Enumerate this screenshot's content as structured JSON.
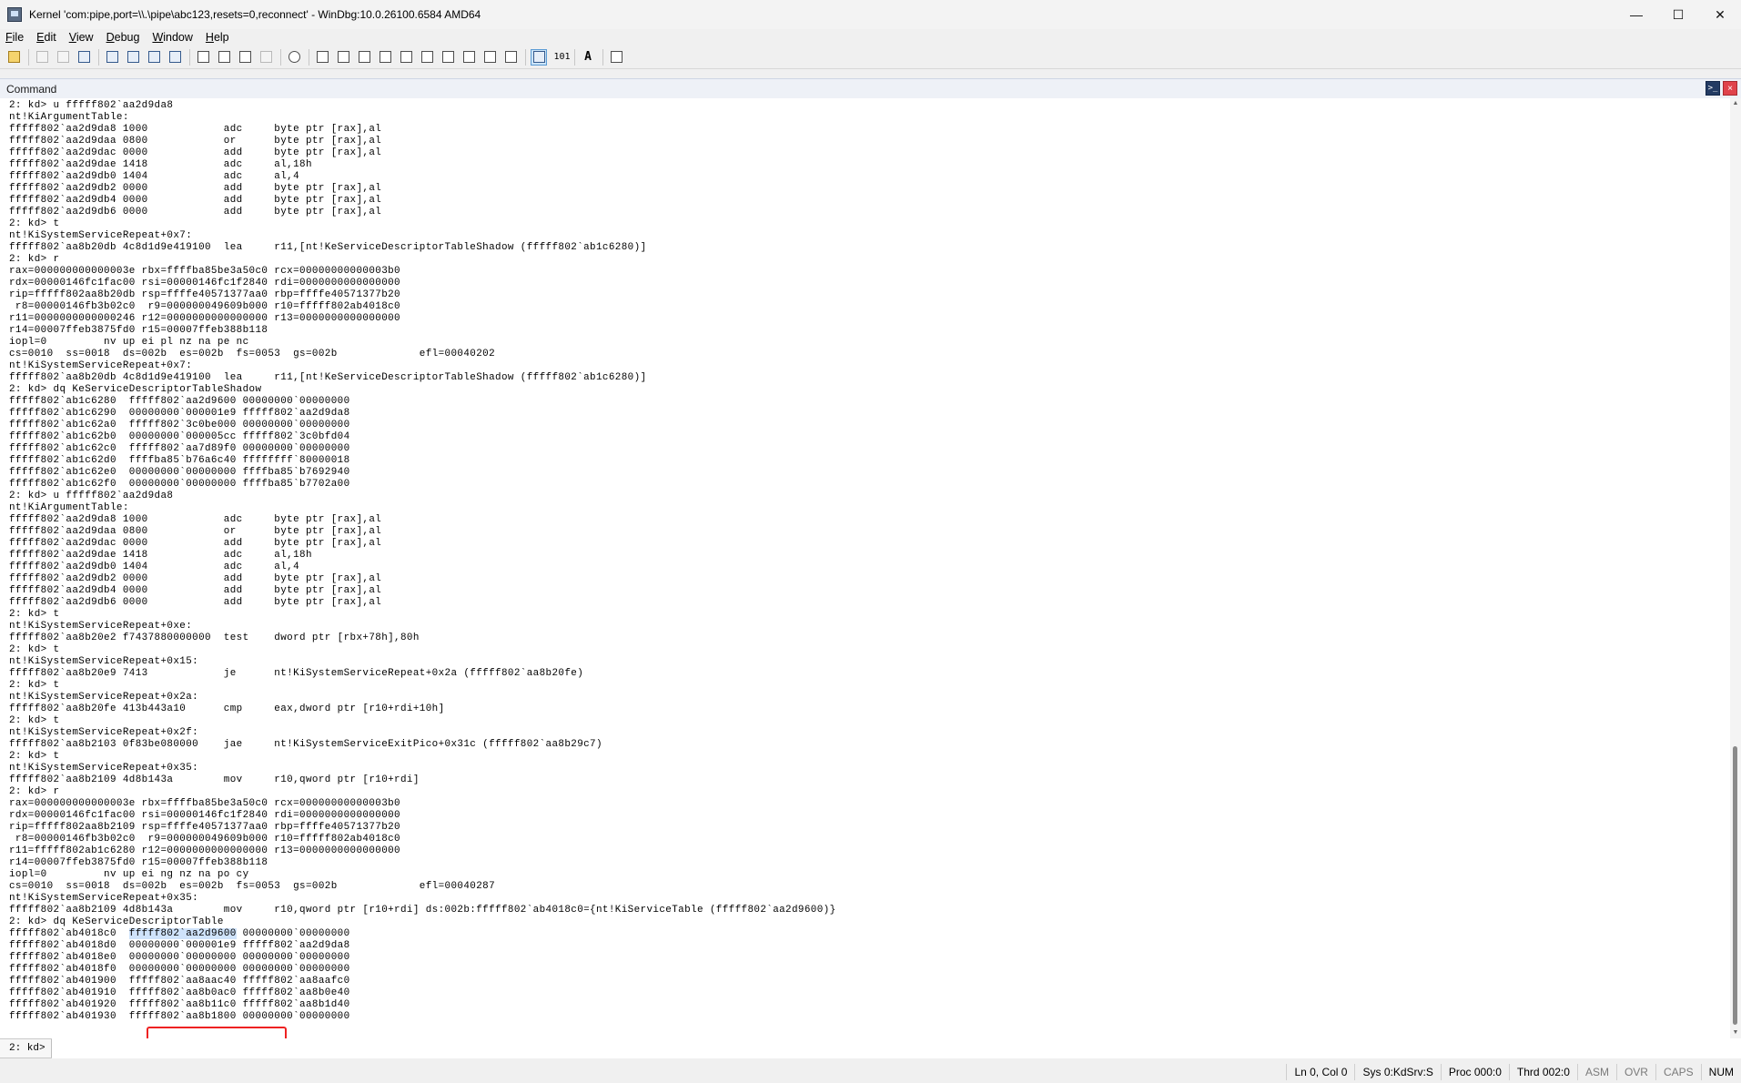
{
  "window": {
    "title": "Kernel 'com:pipe,port=\\\\.\\pipe\\abc123,resets=0,reconnect' - WinDbg:10.0.26100.6584 AMD64",
    "minimize": "—",
    "maximize": "☐",
    "close": "✕"
  },
  "menu": {
    "items": [
      {
        "u": "F",
        "rest": "ile"
      },
      {
        "u": "E",
        "rest": "dit"
      },
      {
        "u": "V",
        "rest": "iew"
      },
      {
        "u": "D",
        "rest": "ebug"
      },
      {
        "u": "W",
        "rest": "indow"
      },
      {
        "u": "H",
        "rest": "elp"
      }
    ]
  },
  "toolbar": {
    "source_mode_label": "101",
    "font_label": "A"
  },
  "panel": {
    "title": "Command",
    "cmd_icon": ">_",
    "close_icon": "×"
  },
  "output": {
    "lines_a": [
      "2: kd> u fffff802`aa2d9da8",
      "nt!KiArgumentTable:",
      "fffff802`aa2d9da8 1000            adc     byte ptr [rax],al",
      "fffff802`aa2d9daa 0800            or      byte ptr [rax],al",
      "fffff802`aa2d9dac 0000            add     byte ptr [rax],al",
      "fffff802`aa2d9dae 1418            adc     al,18h",
      "fffff802`aa2d9db0 1404            adc     al,4",
      "fffff802`aa2d9db2 0000            add     byte ptr [rax],al",
      "fffff802`aa2d9db4 0000            add     byte ptr [rax],al",
      "fffff802`aa2d9db6 0000            add     byte ptr [rax],al",
      "2: kd> t",
      "nt!KiSystemServiceRepeat+0x7:",
      "fffff802`aa8b20db 4c8d1d9e419100  lea     r11,[nt!KeServiceDescriptorTableShadow (fffff802`ab1c6280)]",
      "2: kd> r",
      "rax=000000000000003e rbx=ffffba85be3a50c0 rcx=00000000000003b0",
      "rdx=00000146fc1fac00 rsi=00000146fc1f2840 rdi=0000000000000000",
      "rip=fffff802aa8b20db rsp=ffffe40571377aa0 rbp=ffffe40571377b20",
      " r8=00000146fb3b02c0  r9=000000049609b000 r10=fffff802ab4018c0",
      "r11=0000000000000246 r12=0000000000000000 r13=0000000000000000",
      "r14=00007ffeb3875fd0 r15=00007ffeb388b118",
      "iopl=0         nv up ei pl nz na pe nc",
      "cs=0010  ss=0018  ds=002b  es=002b  fs=0053  gs=002b             efl=00040202",
      "nt!KiSystemServiceRepeat+0x7:",
      "fffff802`aa8b20db 4c8d1d9e419100  lea     r11,[nt!KeServiceDescriptorTableShadow (fffff802`ab1c6280)]",
      "2: kd> dq KeServiceDescriptorTableShadow",
      "fffff802`ab1c6280  fffff802`aa2d9600 00000000`00000000",
      "fffff802`ab1c6290  00000000`000001e9 fffff802`aa2d9da8",
      "fffff802`ab1c62a0  fffff802`3c0be000 00000000`00000000",
      "fffff802`ab1c62b0  00000000`000005cc fffff802`3c0bfd04",
      "fffff802`ab1c62c0  fffff802`aa7d89f0 00000000`00000000",
      "fffff802`ab1c62d0  ffffba85`b76a6c40 ffffffff`80000018",
      "fffff802`ab1c62e0  00000000`00000000 ffffba85`b7692940",
      "fffff802`ab1c62f0  00000000`00000000 ffffba85`b7702a00",
      "2: kd> u fffff802`aa2d9da8",
      "nt!KiArgumentTable:",
      "fffff802`aa2d9da8 1000            adc     byte ptr [rax],al",
      "fffff802`aa2d9daa 0800            or      byte ptr [rax],al",
      "fffff802`aa2d9dac 0000            add     byte ptr [rax],al",
      "fffff802`aa2d9dae 1418            adc     al,18h",
      "fffff802`aa2d9db0 1404            adc     al,4",
      "fffff802`aa2d9db2 0000            add     byte ptr [rax],al",
      "fffff802`aa2d9db4 0000            add     byte ptr [rax],al",
      "fffff802`aa2d9db6 0000            add     byte ptr [rax],al",
      "2: kd> t",
      "nt!KiSystemServiceRepeat+0xe:",
      "fffff802`aa8b20e2 f7437880000000  test    dword ptr [rbx+78h],80h",
      "2: kd> t",
      "nt!KiSystemServiceRepeat+0x15:",
      "fffff802`aa8b20e9 7413            je      nt!KiSystemServiceRepeat+0x2a (fffff802`aa8b20fe)",
      "2: kd> t",
      "nt!KiSystemServiceRepeat+0x2a:",
      "fffff802`aa8b20fe 413b443a10      cmp     eax,dword ptr [r10+rdi+10h]",
      "2: kd> t",
      "nt!KiSystemServiceRepeat+0x2f:",
      "fffff802`aa8b2103 0f83be080000    jae     nt!KiSystemServiceExitPico+0x31c (fffff802`aa8b29c7)",
      "2: kd> t",
      "nt!KiSystemServiceRepeat+0x35:",
      "fffff802`aa8b2109 4d8b143a        mov     r10,qword ptr [r10+rdi]",
      "2: kd> r",
      "rax=000000000000003e rbx=ffffba85be3a50c0 rcx=00000000000003b0",
      "rdx=00000146fc1fac00 rsi=00000146fc1f2840 rdi=0000000000000000",
      "rip=fffff802aa8b2109 rsp=ffffe40571377aa0 rbp=ffffe40571377b20",
      " r8=00000146fb3b02c0  r9=000000049609b000 r10=fffff802ab4018c0",
      "r11=fffff802ab1c6280 r12=0000000000000000 r13=0000000000000000",
      "r14=00007ffeb3875fd0 r15=00007ffeb388b118",
      "iopl=0         nv up ei ng nz na po cy",
      "cs=0010  ss=0018  ds=002b  es=002b  fs=0053  gs=002b             efl=00040287",
      "nt!KiSystemServiceRepeat+0x35:",
      "fffff802`aa8b2109 4d8b143a        mov     r10,qword ptr [r10+rdi] ds:002b:fffff802`ab4018c0={nt!KiServiceTable (fffff802`aa2d9600)}",
      "2: kd> dq KeServiceDescriptorTable"
    ],
    "hl_prefix": "fffff802`ab4018c0  ",
    "hl_value": "fffff802`aa2d9600",
    "hl_suffix": " 00000000`00000000",
    "lines_b": [
      "fffff802`ab4018d0  00000000`000001e9 fffff802`aa2d9da8",
      "fffff802`ab4018e0  00000000`00000000 00000000`00000000",
      "fffff802`ab4018f0  00000000`00000000 00000000`00000000",
      "fffff802`ab401900  fffff802`aa8aac40 fffff802`aa8aafc0",
      "fffff802`ab401910  fffff802`aa8b0ac0 fffff802`aa8b0e40",
      "fffff802`ab401920  fffff802`aa8b11c0 fffff802`aa8b1d40",
      "fffff802`ab401930  fffff802`aa8b1800 00000000`00000000"
    ]
  },
  "command": {
    "prompt": "2: kd>",
    "value": ""
  },
  "status": {
    "cells": [
      "Ln 0, Col 0",
      "Sys 0:KdSrv:S",
      "Proc 000:0",
      "Thrd 002:0",
      "ASM",
      "OVR",
      "CAPS",
      "NUM"
    ]
  }
}
